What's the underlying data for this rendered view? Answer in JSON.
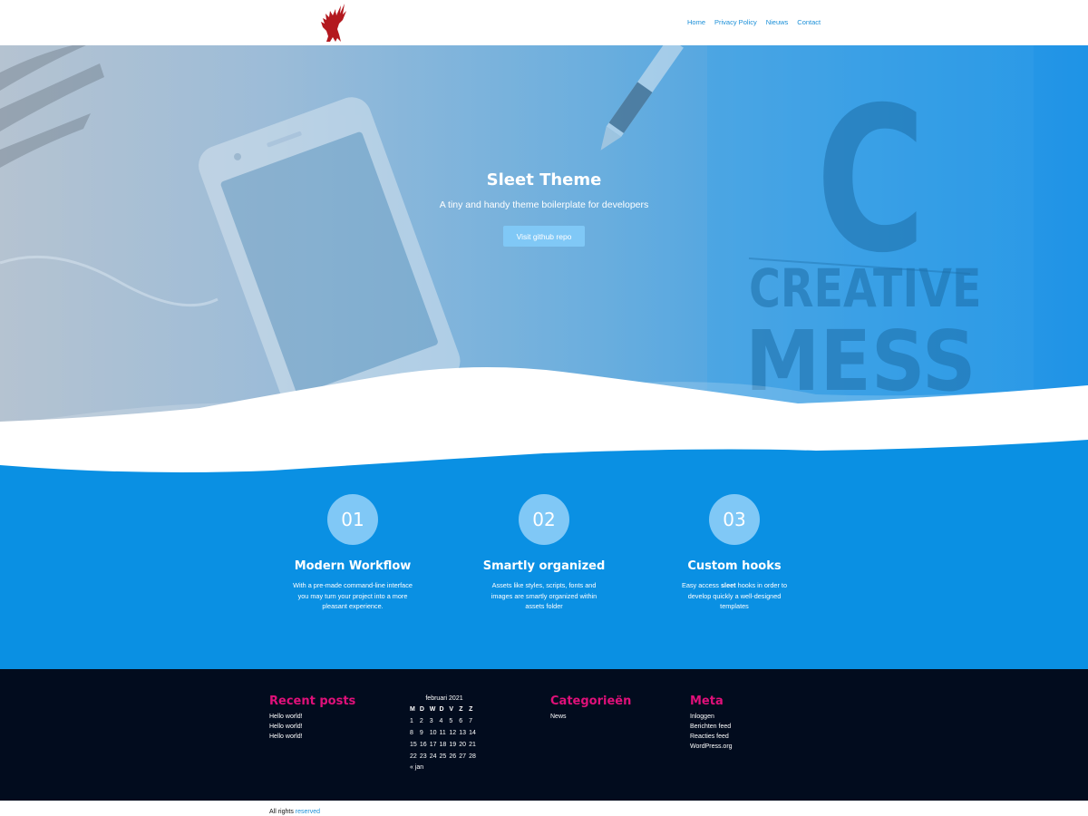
{
  "header": {
    "nav": [
      {
        "label": "Home"
      },
      {
        "label": "Privacy Policy"
      },
      {
        "label": "Nieuws"
      },
      {
        "label": "Contact"
      }
    ]
  },
  "hero": {
    "title": "Sleet Theme",
    "subtitle": "A tiny and handy theme boilerplate for developers",
    "button_label": "Visit github repo",
    "background_words": [
      "C",
      "CREATIVE",
      "MESS"
    ]
  },
  "features": [
    {
      "number": "01",
      "title": "Modern Workflow",
      "desc_lines": [
        "With a pre-made command-line interface",
        "you may turn your project into a more",
        "pleasant experience."
      ]
    },
    {
      "number": "02",
      "title": "Smartly organized",
      "desc_lines": [
        "Assets like styles, scripts, fonts and",
        "images are smartly organized within",
        "assets folder"
      ]
    },
    {
      "number": "03",
      "title": "Custom hooks",
      "desc_line1_before": "Easy access ",
      "desc_line1_bold": "sleet",
      "desc_line1_after": " hooks in order to",
      "desc_lines": [
        "develop quickly a well-designed",
        "templates"
      ]
    }
  ],
  "footer": {
    "recent_posts": {
      "title": "Recent posts",
      "items": [
        "Hello world!",
        "Hello world!",
        "Hello world!"
      ]
    },
    "calendar": {
      "caption": "februari 2021",
      "weekdays": [
        "M",
        "D",
        "W",
        "D",
        "V",
        "Z",
        "Z"
      ],
      "weeks": [
        [
          "1",
          "2",
          "3",
          "4",
          "5",
          "6",
          "7"
        ],
        [
          "8",
          "9",
          "10",
          "11",
          "12",
          "13",
          "14"
        ],
        [
          "15",
          "16",
          "17",
          "18",
          "19",
          "20",
          "21"
        ],
        [
          "22",
          "23",
          "24",
          "25",
          "26",
          "27",
          "28"
        ]
      ],
      "prev_label": "« jan"
    },
    "categories": {
      "title": "Categorieën",
      "items": [
        "News"
      ]
    },
    "meta": {
      "title": "Meta",
      "items": [
        "Inloggen",
        "Berichten feed",
        "Reacties feed",
        "WordPress.org"
      ]
    }
  },
  "bottom": {
    "text": "All rights",
    "link": "reserved"
  },
  "colors": {
    "accent": "#1a8fd8",
    "feature_bg": "#0a90e3",
    "footer_bg": "#020c1e",
    "widget_title": "#e0107a",
    "button": "#80c8f6"
  }
}
